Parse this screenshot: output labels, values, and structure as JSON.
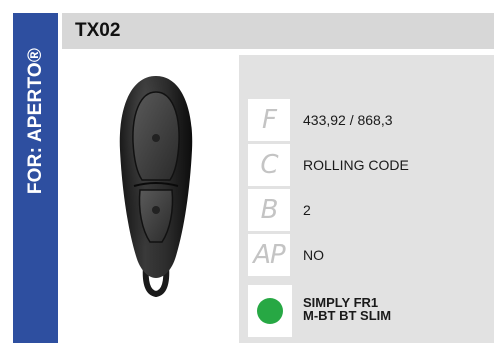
{
  "brand": {
    "label": "FOR: APERTO®",
    "color": "#2e4fa0"
  },
  "product": {
    "code": "TX02",
    "image_icon": "remote-control-photo"
  },
  "specs": [
    {
      "letter": "F",
      "value": "433,92 / 868,3"
    },
    {
      "letter": "C",
      "value": "ROLLING CODE"
    },
    {
      "letter": "B",
      "value": "2"
    },
    {
      "letter": "AP",
      "value": "NO"
    }
  ],
  "compatibility": {
    "dot_color": "#27a844",
    "line1": "SIMPLY FR1",
    "line2": "M-BT BT SLIM"
  }
}
